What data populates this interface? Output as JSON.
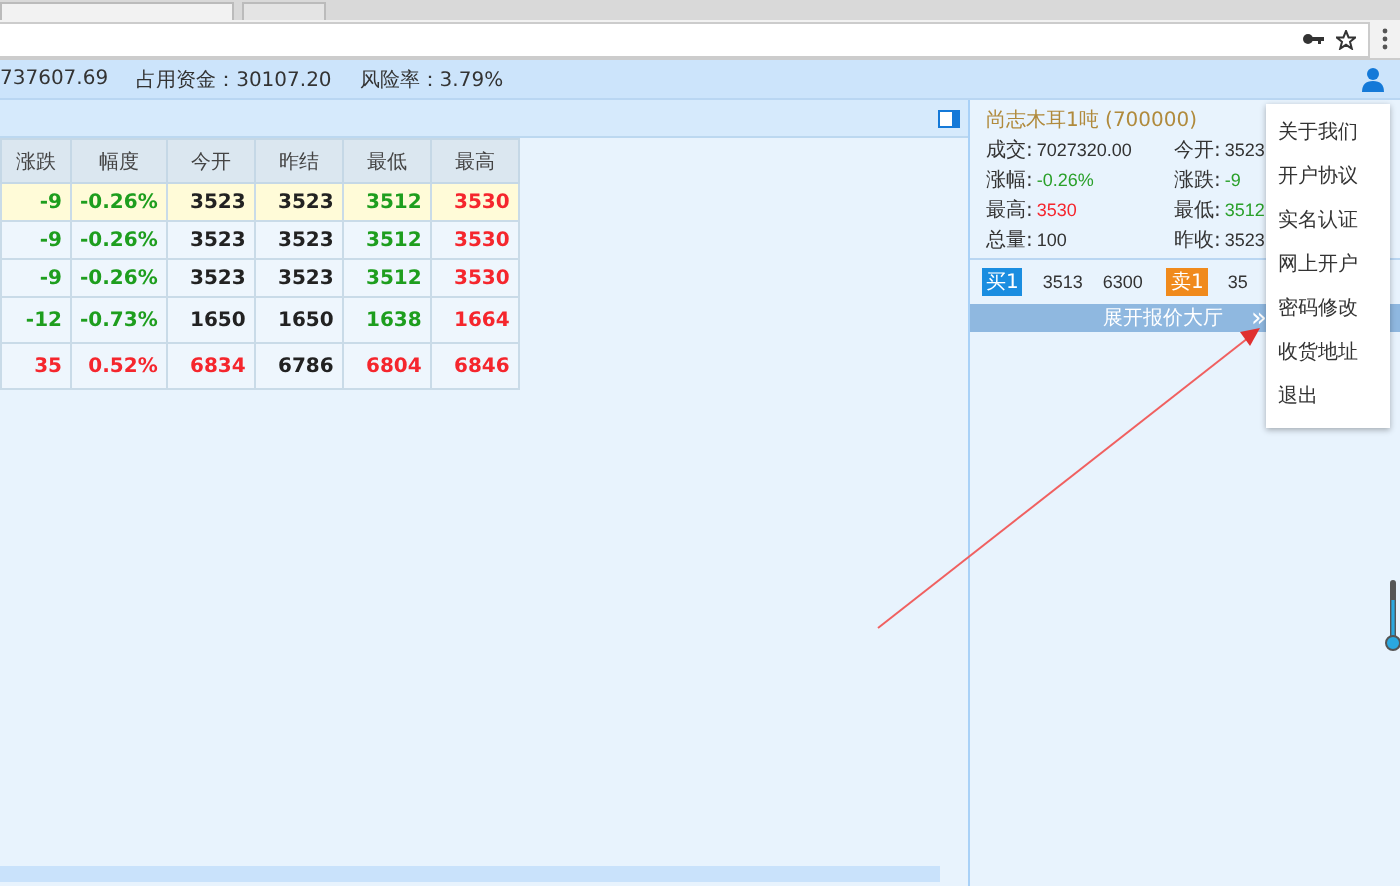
{
  "account_bar": {
    "items": [
      "737607.69",
      "占用资金：30107.20",
      "风险率：3.79%"
    ]
  },
  "table": {
    "columns": [
      "涨跌",
      "幅度",
      "今开",
      "昨结",
      "最低",
      "最高"
    ],
    "rows": [
      {
        "selected": true,
        "cells": [
          {
            "text": "-9",
            "color": "#1e9e1e"
          },
          {
            "text": "-0.26%",
            "color": "#1e9e1e"
          },
          {
            "text": "3523",
            "color": "#222222"
          },
          {
            "text": "3523",
            "color": "#222222"
          },
          {
            "text": "3512",
            "color": "#1e9e1e"
          },
          {
            "text": "3530",
            "color": "#f5262d"
          }
        ]
      },
      {
        "selected": false,
        "cells": [
          {
            "text": "-9",
            "color": "#1e9e1e"
          },
          {
            "text": "-0.26%",
            "color": "#1e9e1e"
          },
          {
            "text": "3523",
            "color": "#222222"
          },
          {
            "text": "3523",
            "color": "#222222"
          },
          {
            "text": "3512",
            "color": "#1e9e1e"
          },
          {
            "text": "3530",
            "color": "#f5262d"
          }
        ]
      },
      {
        "selected": false,
        "cells": [
          {
            "text": "-9",
            "color": "#1e9e1e"
          },
          {
            "text": "-0.26%",
            "color": "#1e9e1e"
          },
          {
            "text": "3523",
            "color": "#222222"
          },
          {
            "text": "3523",
            "color": "#222222"
          },
          {
            "text": "3512",
            "color": "#1e9e1e"
          },
          {
            "text": "3530",
            "color": "#f5262d"
          }
        ]
      },
      {
        "selected": false,
        "cells": [
          {
            "text": "-12",
            "color": "#1e9e1e"
          },
          {
            "text": "-0.73%",
            "color": "#1e9e1e"
          },
          {
            "text": "1650",
            "color": "#222222"
          },
          {
            "text": "1650",
            "color": "#222222"
          },
          {
            "text": "1638",
            "color": "#1e9e1e"
          },
          {
            "text": "1664",
            "color": "#f5262d"
          }
        ]
      },
      {
        "selected": false,
        "cells": [
          {
            "text": "35",
            "color": "#f5262d"
          },
          {
            "text": "0.52%",
            "color": "#f5262d"
          },
          {
            "text": "6834",
            "color": "#f5262d"
          },
          {
            "text": "6786",
            "color": "#222222"
          },
          {
            "text": "6804",
            "color": "#f5262d"
          },
          {
            "text": "6846",
            "color": "#f5262d"
          }
        ]
      }
    ]
  },
  "quote": {
    "title": "尚志木耳1吨 (700000)",
    "stats": [
      {
        "label": "成交:",
        "value": "7027320.00",
        "color": "#333333"
      },
      {
        "label": "今开:",
        "value": "3523",
        "color": "#333333"
      },
      {
        "label": "涨幅:",
        "value": "-0.26%",
        "color": "#2aa02a"
      },
      {
        "label": "涨跌:",
        "value": "-9",
        "color": "#2aa02a"
      },
      {
        "label": "最高:",
        "value": "3530",
        "color": "#f5262d"
      },
      {
        "label": "最低:",
        "value": "3512",
        "color": "#2aa02a"
      },
      {
        "label": "总量:",
        "value": "100",
        "color": "#333333"
      },
      {
        "label": "昨收:",
        "value": "3523",
        "color": "#333333"
      }
    ],
    "book": [
      {
        "kind": "buy",
        "badge": "买1",
        "price": "3513",
        "volume": "6300"
      },
      {
        "kind": "sell",
        "badge": "卖1",
        "price": "35"
      }
    ],
    "expand_button": {
      "label": "展开报价大厅",
      "arrow": "»"
    }
  },
  "user_menu": {
    "items": [
      "关于我们",
      "开户协议",
      "实名认证",
      "网上开户",
      "密码修改",
      "收货地址",
      "退出"
    ]
  }
}
